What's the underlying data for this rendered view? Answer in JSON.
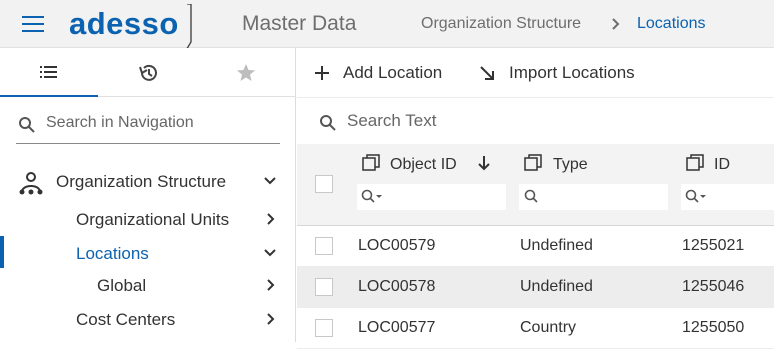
{
  "header": {
    "logo": "adesso",
    "app_title": "Master Data",
    "breadcrumb": [
      "Organization Structure",
      "Locations"
    ]
  },
  "colors": {
    "accent": "#0b62b0",
    "header_bg": "#f2f2f2",
    "alt_row": "#ededed"
  },
  "sidebar": {
    "tabs": [
      {
        "icon": "list-icon",
        "active": true
      },
      {
        "icon": "history-icon",
        "active": false
      },
      {
        "icon": "star-icon",
        "active": false
      }
    ],
    "search_placeholder": "Search in Navigation",
    "items": [
      {
        "label": "Organization Structure",
        "icon": "org-structure-icon",
        "chevron": "down"
      },
      {
        "label": "Organizational Units",
        "chevron": "right"
      },
      {
        "label": "Locations",
        "chevron": "down",
        "active": true
      },
      {
        "label": "Global",
        "chevron": "right"
      },
      {
        "label": "Cost Centers",
        "chevron": "right"
      }
    ]
  },
  "toolbar": {
    "add_label": "Add Location",
    "import_label": "Import Locations"
  },
  "search_placeholder": "Search Text",
  "table": {
    "columns": [
      "Object ID",
      "Type",
      "ID"
    ],
    "sort_column": "Object ID",
    "sort_direction": "desc",
    "rows": [
      [
        "LOC00579",
        "Undefined",
        "1255021"
      ],
      [
        "LOC00578",
        "Undefined",
        "1255046"
      ],
      [
        "LOC00577",
        "Country",
        "1255050"
      ]
    ]
  }
}
